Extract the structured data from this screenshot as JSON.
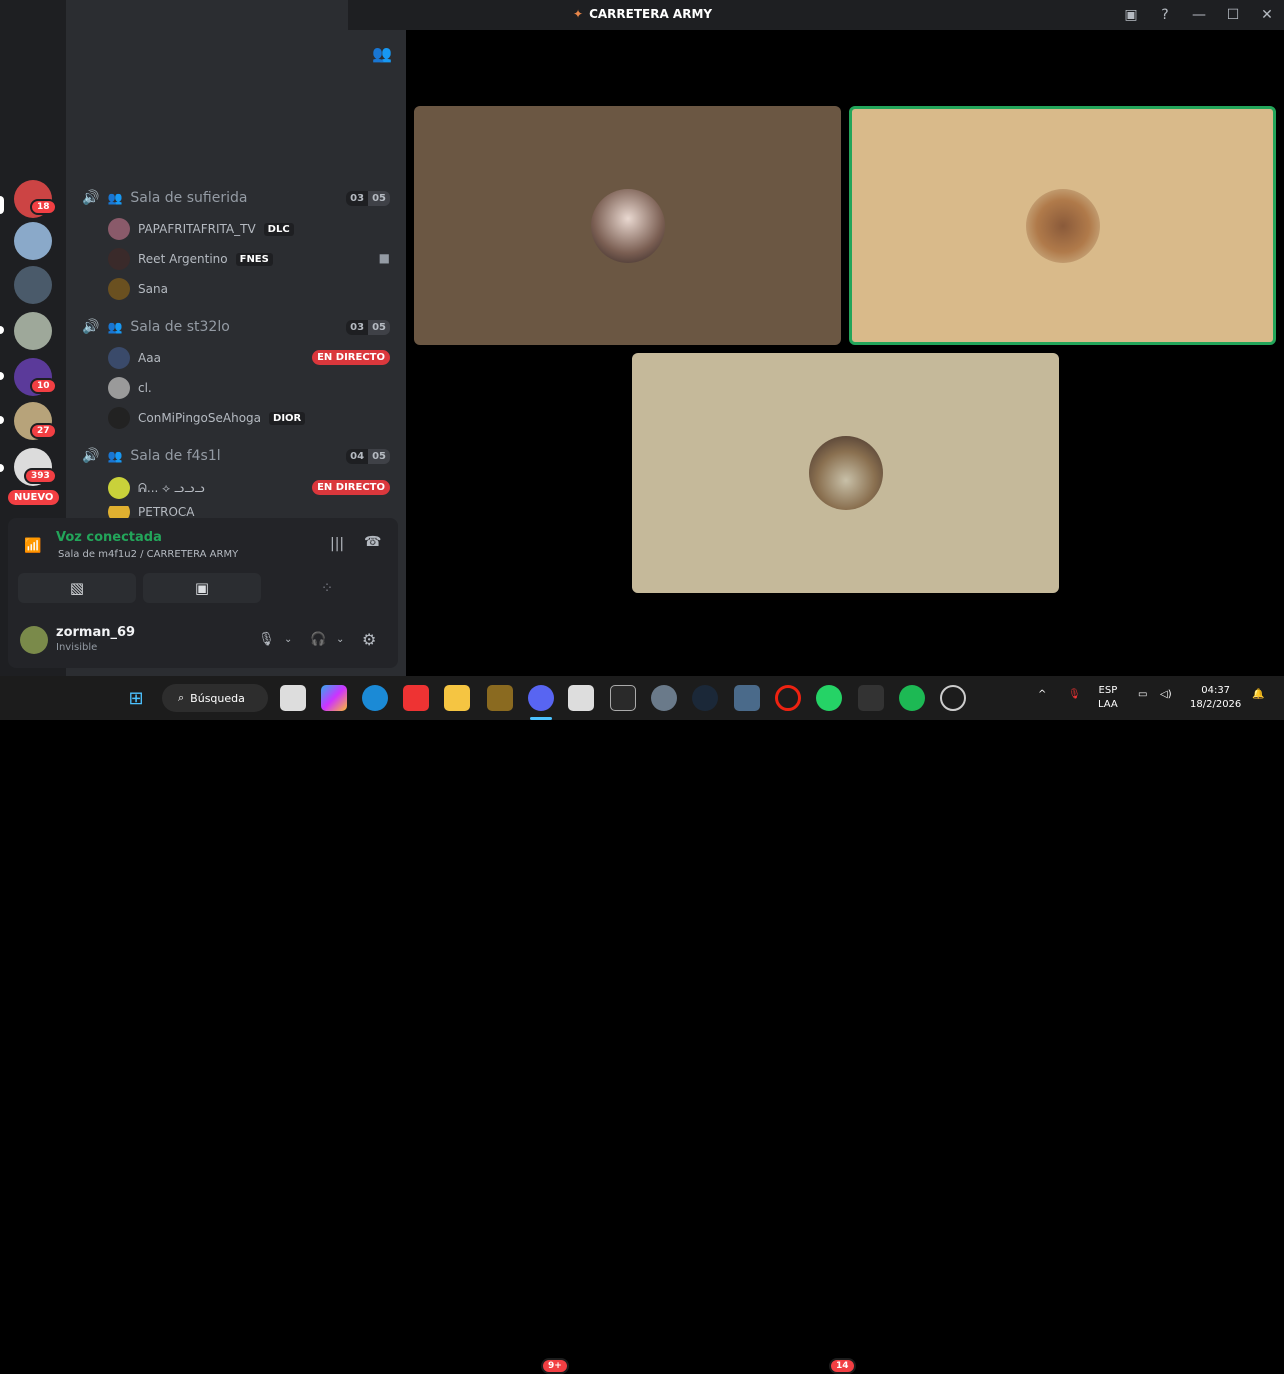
{
  "window": {
    "title": "CARRETERA ARMY"
  },
  "rail": {
    "badges": [
      "18",
      "10",
      "27",
      "393"
    ],
    "new_label": "NUEVO"
  },
  "channels": [
    {
      "name": "Sala de sufierida",
      "count_a": "03",
      "count_b": "05",
      "users": [
        {
          "name": "PAPAFRITAFRITA_TV",
          "tag": "DLC"
        },
        {
          "name": "Reet Argentino",
          "tag": "FNES"
        },
        {
          "name": "Sana",
          "tag": ""
        }
      ]
    },
    {
      "name": "Sala de st32lo",
      "count_a": "03",
      "count_b": "05",
      "users": [
        {
          "name": "Aaa",
          "tag": ""
        },
        {
          "name": "cl.",
          "tag": ""
        },
        {
          "name": "ConMiPingoSeAhoga",
          "tag": "DIOR"
        }
      ]
    },
    {
      "name": "Sala de f4s1l",
      "count_a": "04",
      "count_b": "05",
      "users": [
        {
          "name": "ᕱ... ⟡ ᓗᓗᓗ",
          "tag": ""
        },
        {
          "name": "PETROCA",
          "tag": ""
        }
      ]
    }
  ],
  "live_label": "EN DIRECTO",
  "voice": {
    "status": "Voz conectada",
    "location": "Sala de m4f1u2 / CARRETERA ARMY"
  },
  "user": {
    "name": "zorman_69",
    "status": "Invisible"
  },
  "taskbar": {
    "search": "Búsqueda",
    "discord_badge": "9+",
    "whatsapp_badge": "14",
    "lang": "ESP",
    "layout": "LAA",
    "time": "04:37",
    "date": "18/2/2026"
  },
  "colors": {
    "tile1": "#6b5743",
    "tile2": "#d9ba8a",
    "tile3": "#c5b99a",
    "speaking": "#23a55a",
    "live": "#da373c"
  }
}
